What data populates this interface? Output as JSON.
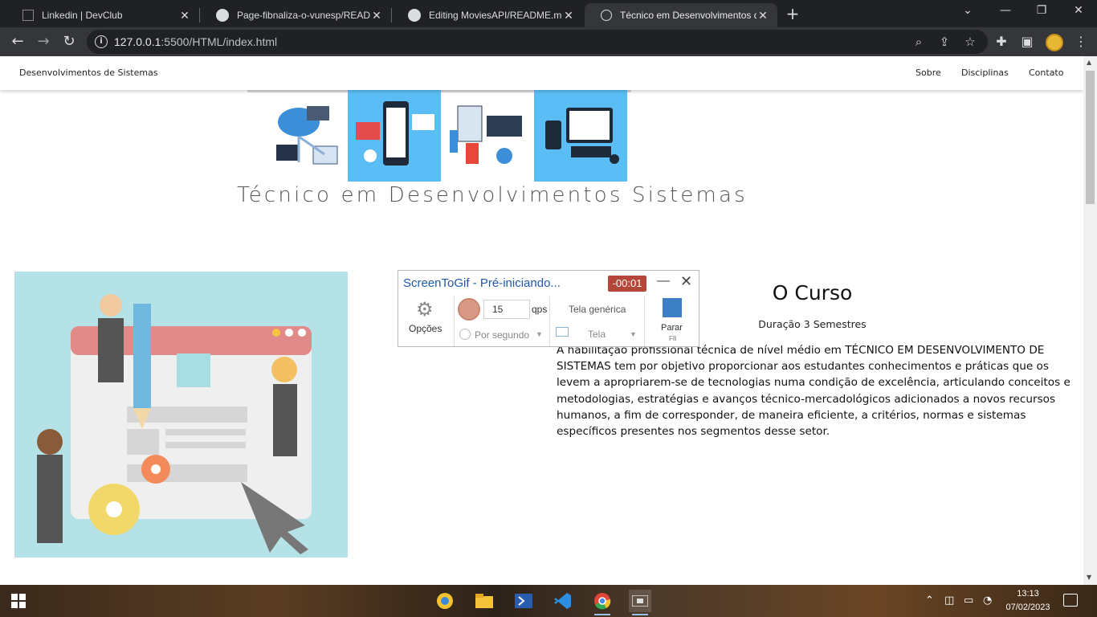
{
  "browser": {
    "tabs": [
      {
        "title": "Linkedin | DevClub",
        "close": "✕"
      },
      {
        "title": "Page-fibnaliza-o-vunesp/READM",
        "close": "✕"
      },
      {
        "title": "Editing MoviesAPI/README.md a",
        "close": "✕"
      },
      {
        "title": "Técnico em Desenvolvimentos de",
        "close": "✕"
      }
    ],
    "new_tab": "+",
    "url_host": "127.0.0.1",
    "url_rest": ":5500/HTML/index.html"
  },
  "site": {
    "brand": "Desenvolvimentos de Sistemas",
    "nav": [
      "Sobre",
      "Disciplinas",
      "Contato"
    ],
    "hero_title": "Técnico em Desenvolvimentos Sistemas",
    "curso": {
      "title": "O Curso",
      "duration": "Duração 3 Semestres",
      "text": "A habilitação profissional técnica de nível médio em TÉCNICO EM DESENVOLVIMENTO DE SISTEMAS tem por objetivo proporcionar aos estudantes conhecimentos e práticas que os levem a apropriarem-se de tecnologias numa condição de excelência, articulando conceitos e metodologias, estratégias e avanços técnico-mercadológicos adicionados a novos recursos humanos, a fim de corresponder, de maneira eficiente, a critérios, normas e sistemas específicos presentes nos segmentos desse setor."
    }
  },
  "screentogif": {
    "title": "ScreenToGif - Pré-iniciando...",
    "timer": "-00:01",
    "options": "Opções",
    "fps_value": "15",
    "fps_unit": "qps",
    "per_second": "Por segundo",
    "screen_generic": "Tela genérica",
    "screen": "Tela",
    "stop_label": "Parar",
    "stop_key": "F8"
  },
  "taskbar": {
    "time": "13:13",
    "date": "07/02/2023"
  }
}
